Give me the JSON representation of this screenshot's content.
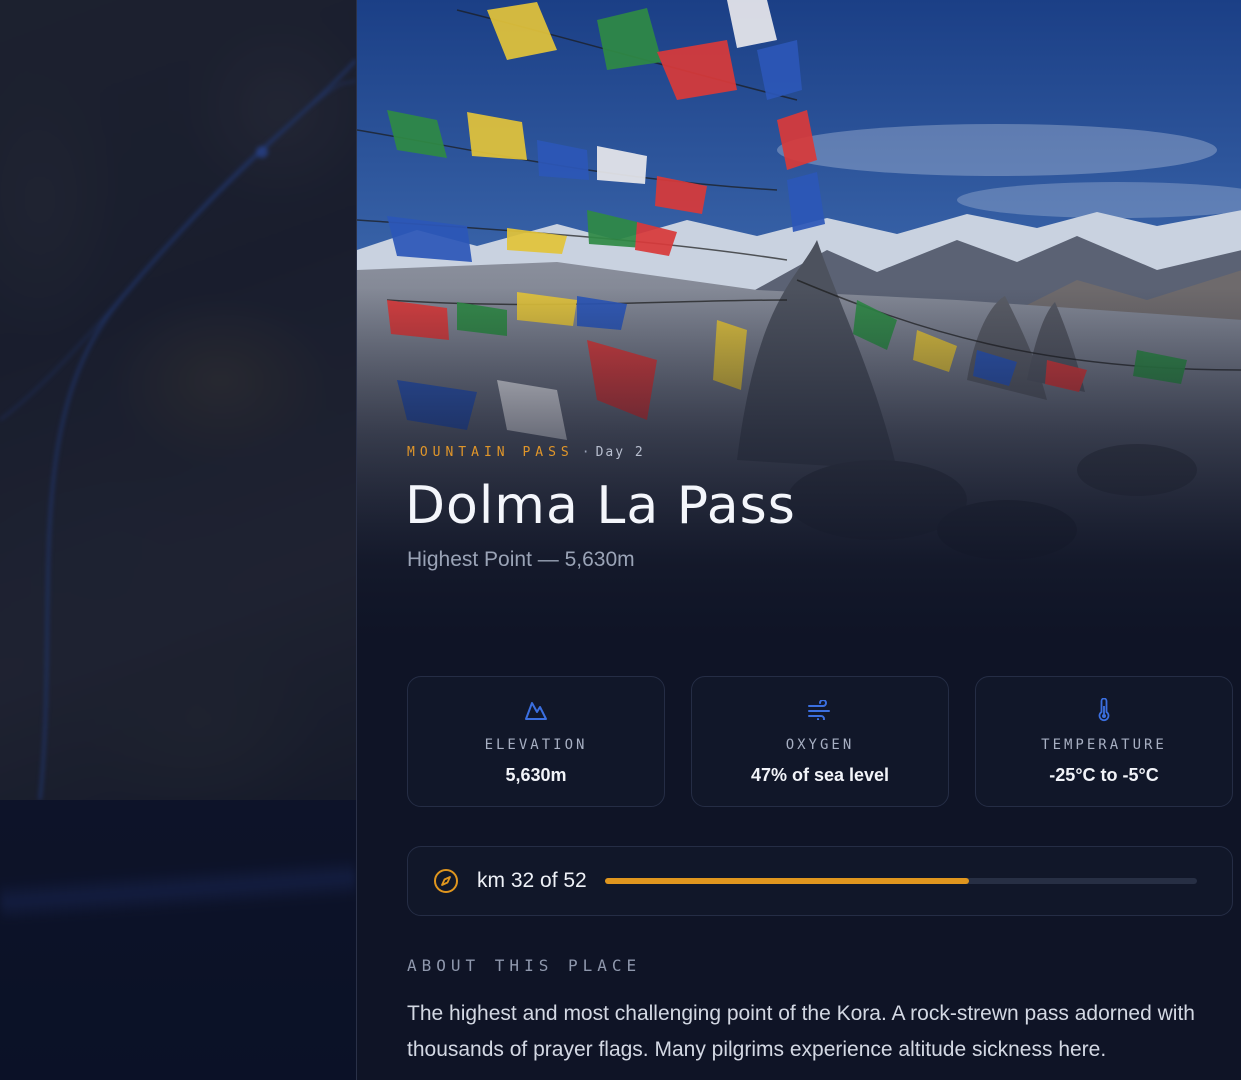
{
  "place": {
    "category": "MOUNTAIN PASS",
    "separator": "·",
    "day": "Day 2",
    "title": "Dolma La Pass",
    "subtitle": "Highest Point — 5,630m"
  },
  "stats": [
    {
      "icon": "mountain-icon",
      "label": "ELEVATION",
      "value": "5,630m"
    },
    {
      "icon": "wind-icon",
      "label": "OXYGEN",
      "value": "47% of sea level"
    },
    {
      "icon": "thermometer-icon",
      "label": "TEMPERATURE",
      "value": "-25°C to -5°C"
    }
  ],
  "progress": {
    "icon": "compass-icon",
    "text": "km 32 of 52",
    "current_km": 32,
    "total_km": 52,
    "fraction": 0.615
  },
  "about": {
    "heading": "ABOUT THIS PLACE",
    "text": "The highest and most challenging point of the Kora. A rock-strewn pass adorned with thousands of prayer flags. Many pilgrims experience altitude sickness here."
  },
  "colors": {
    "accent": "#e0961e",
    "icon_blue": "#3b6fe0",
    "panel_bg": "#0f1426",
    "card_border": "#252d45"
  }
}
